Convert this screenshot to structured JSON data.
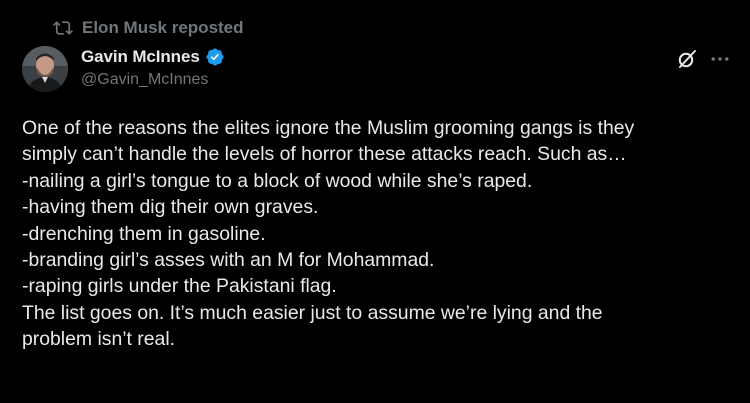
{
  "repost": {
    "label": "Elon Musk reposted"
  },
  "author": {
    "display_name": "Gavin McInnes",
    "handle": "@Gavin_McInnes",
    "verified": true
  },
  "tweet": {
    "lines": [
      "One of the reasons the elites ignore the Muslim grooming gangs is they",
      "simply can’t handle the levels of horror these attacks reach. Such as…",
      "-nailing a girl’s tongue to a block of wood while she’s raped.",
      "-having them dig their own graves.",
      "-drenching them in gasoline.",
      "-branding girl’s asses with an M for Mohammad.",
      "-raping girls under the Pakistani flag.",
      "The list goes on. It’s much easier just to assume we’re lying and the",
      "problem isn’t real."
    ]
  },
  "icons": {
    "repost": "repost-icon",
    "verified": "verified-badge-icon",
    "grok": "grok-icon",
    "more": "more-horizontal-icon"
  },
  "colors": {
    "background": "#000000",
    "text_primary": "#e7e9ea",
    "text_secondary": "#71767b",
    "verified_blue": "#1d9bf0"
  }
}
